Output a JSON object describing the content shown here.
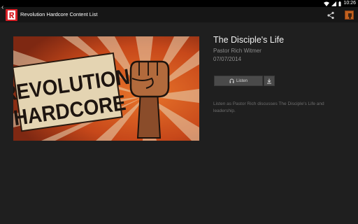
{
  "status_bar": {
    "time": "10:26"
  },
  "action_bar": {
    "back_icon": "chevron-left-icon",
    "title": "Revolution Hardcore Content List"
  },
  "artwork": {
    "line1": "REVOLUTION",
    "line2": "HARDCORE"
  },
  "episode": {
    "title": "The Disciple's Life",
    "speaker": "Pastor Rich Witmer",
    "date": "07/07/2014",
    "description": "Listen as Pastor Rich discusses The Disciple's Life and leadership."
  },
  "actions": {
    "listen_label": "Listen",
    "listen_icon": "headphones-icon",
    "download_icon": "download-icon"
  },
  "colors": {
    "action_bar": "#161616",
    "background": "#1f1f1f",
    "logo_red": "#d61f26",
    "artwork_orange": "#c94e1b"
  }
}
